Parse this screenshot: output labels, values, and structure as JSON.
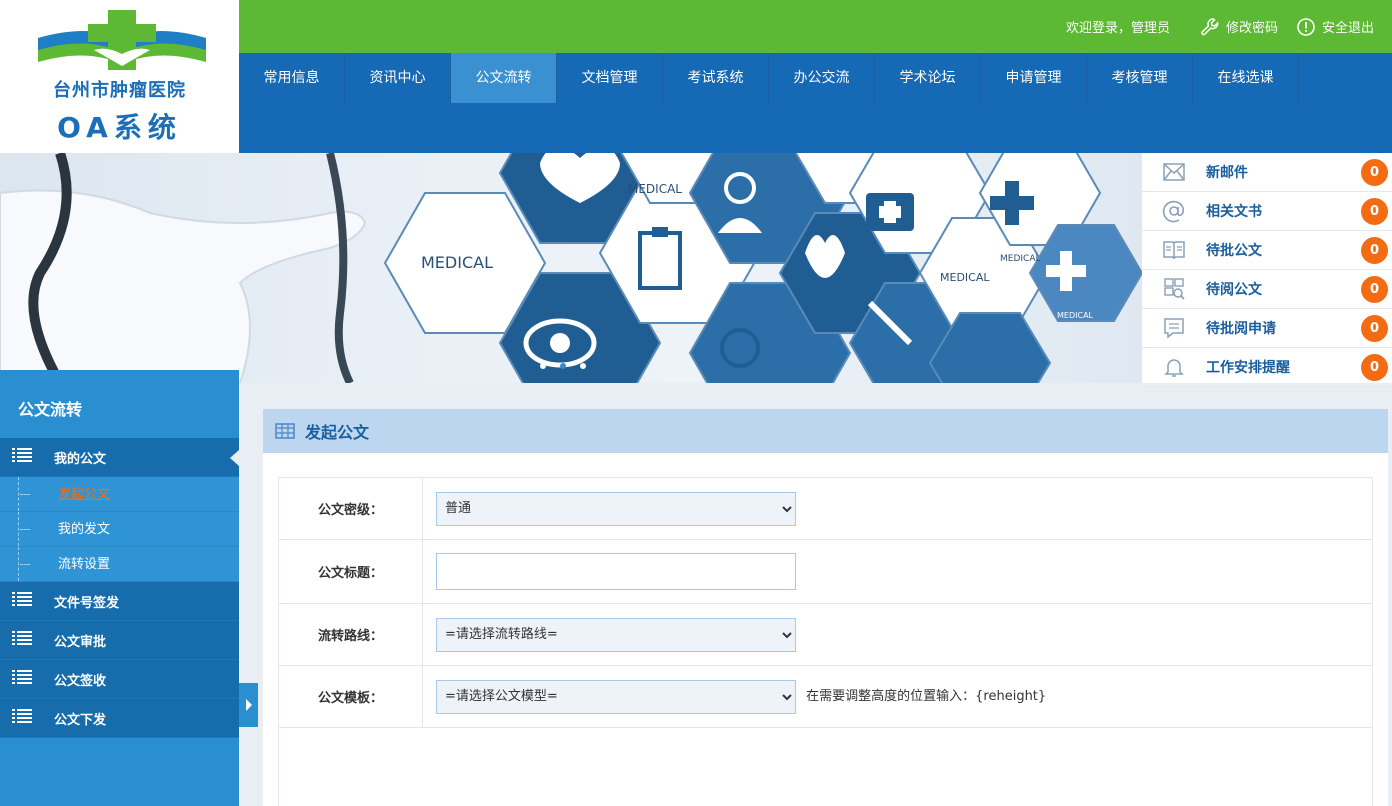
{
  "logo": {
    "hospital_name": "台州市肿瘤医院",
    "system_name": "OA系统"
  },
  "topbar": {
    "welcome": "欢迎登录，管理员",
    "change_password": "修改密码",
    "logout": "安全退出"
  },
  "nav": {
    "items": [
      {
        "label": "常用信息"
      },
      {
        "label": "资讯中心"
      },
      {
        "label": "公文流转",
        "active": true
      },
      {
        "label": "文档管理"
      },
      {
        "label": "考试系统"
      },
      {
        "label": "办公交流"
      },
      {
        "label": "学术论坛"
      },
      {
        "label": "申请管理"
      },
      {
        "label": "考核管理"
      },
      {
        "label": "在线选课"
      }
    ]
  },
  "banner": {
    "texts": [
      "MEDICAL",
      "MEDICAL",
      "MEDICAL",
      "MEDICAL",
      "MEDICAL"
    ]
  },
  "notices": [
    {
      "label": "新邮件",
      "icon": "mail-icon",
      "count": "0"
    },
    {
      "label": "相关文书",
      "icon": "at-icon",
      "count": "0"
    },
    {
      "label": "待批公文",
      "icon": "book-icon",
      "count": "0"
    },
    {
      "label": "待阅公文",
      "icon": "search-doc-icon",
      "count": "0"
    },
    {
      "label": "待批阅申请",
      "icon": "message-icon",
      "count": "0"
    },
    {
      "label": "工作安排提醒",
      "icon": "bell-icon",
      "count": "0"
    }
  ],
  "sidebar": {
    "title": "公文流转",
    "groups": [
      {
        "label": "我的公文",
        "open": true,
        "subs": [
          {
            "label": "发起公文",
            "current": true
          },
          {
            "label": "我的发文"
          },
          {
            "label": "流转设置"
          }
        ]
      },
      {
        "label": "文件号签发"
      },
      {
        "label": "公文审批"
      },
      {
        "label": "公文签收"
      },
      {
        "label": "公文下发"
      }
    ]
  },
  "main": {
    "title": "发起公文",
    "form": {
      "secrecy_label": "公文密级：",
      "secrecy_value": "普通",
      "title_label": "公文标题：",
      "title_value": "",
      "route_label": "流转路线：",
      "route_value": "=请选择流转路线=",
      "template_label": "公文模板：",
      "template_value": "=请选择公文模型=",
      "template_hint": "在需要调整高度的位置输入：{reheight}"
    }
  },
  "colors": {
    "topbar_green": "#5db933",
    "nav_blue": "#1669b4",
    "sidebar_blue": "#2a8fd0",
    "badge_orange": "#f36c14"
  }
}
